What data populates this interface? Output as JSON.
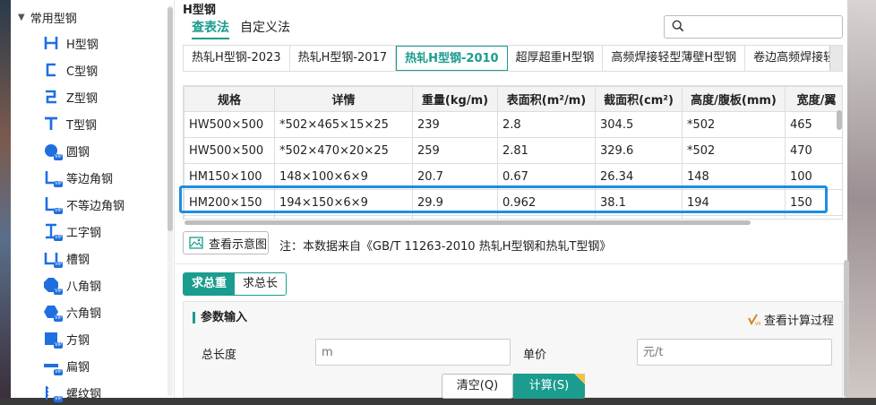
{
  "sidebar": {
    "category": "常用型钢",
    "items": [
      {
        "label": "H型钢",
        "icon": "h-beam-icon",
        "vip": false
      },
      {
        "label": "C型钢",
        "icon": "c-channel-icon",
        "vip": false
      },
      {
        "label": "Z型钢",
        "icon": "z-section-icon",
        "vip": false
      },
      {
        "label": "T型钢",
        "icon": "t-section-icon",
        "vip": false
      },
      {
        "label": "圆钢",
        "icon": "round-bar-icon",
        "vip": true
      },
      {
        "label": "等边角钢",
        "icon": "equal-angle-icon",
        "vip": true
      },
      {
        "label": "不等边角钢",
        "icon": "unequal-angle-icon",
        "vip": true
      },
      {
        "label": "工字钢",
        "icon": "i-beam-icon",
        "vip": true
      },
      {
        "label": "槽钢",
        "icon": "channel-icon",
        "vip": true
      },
      {
        "label": "八角钢",
        "icon": "octagon-bar-icon",
        "vip": true
      },
      {
        "label": "六角钢",
        "icon": "hexagon-bar-icon",
        "vip": true
      },
      {
        "label": "方钢",
        "icon": "square-bar-icon",
        "vip": true
      },
      {
        "label": "扁钢",
        "icon": "flat-bar-icon",
        "vip": true
      },
      {
        "label": "螺纹钢",
        "icon": "rebar-icon",
        "vip": true
      }
    ]
  },
  "main": {
    "title": "H型钢",
    "mode_tabs": [
      "查表法",
      "自定义法"
    ],
    "active_mode": 0,
    "standard_tabs": [
      "热轧H型钢-2023",
      "热轧H型钢-2017",
      "热轧H型钢-2010",
      "超厚超重H型钢",
      "高频焊接轻型薄壁H型钢",
      "卷边高频焊接轻型"
    ],
    "active_standard": 2,
    "table": {
      "headers": [
        "规格",
        "详情",
        "重量(kg/m)",
        "表面积(m²/m)",
        "截面积(cm²)",
        "高度/腹板(mm)",
        "宽度/翼"
      ],
      "rows": [
        [
          "HW500×500",
          "*502×465×15×25",
          "239",
          "2.8",
          "304.5",
          "*502",
          "465"
        ],
        [
          "HW500×500",
          "*502×470×20×25",
          "259",
          "2.81",
          "329.6",
          "*502",
          "470"
        ],
        [
          "HM150×100",
          "148×100×6×9",
          "20.7",
          "0.67",
          "26.34",
          "148",
          "100"
        ],
        [
          "HM200×150",
          "194×150×6×9",
          "29.9",
          "0.962",
          "38.1",
          "194",
          "150"
        ],
        [
          "",
          "",
          "",
          "",
          "",
          "",
          ""
        ]
      ],
      "selected_row": 3
    },
    "view_diagram": "查看示意图",
    "note": "注：本数据来自《GB/T 11263-2010 热轧H型钢和热轧T型钢》",
    "calc_tabs": [
      "求总重",
      "求总长"
    ],
    "active_calc": 0,
    "params": {
      "title": "参数输入",
      "process_link": "查看计算过程",
      "length_label": "总长度",
      "length_placeholder": "m",
      "price_label": "单价",
      "price_placeholder": "元/t"
    },
    "buttons": {
      "clear": "清空(Q)",
      "calc": "计算(S)"
    }
  },
  "colors": {
    "accent": "#1a9c8e",
    "highlight": "#1a8fe0",
    "vip": "#1f6fe0"
  }
}
